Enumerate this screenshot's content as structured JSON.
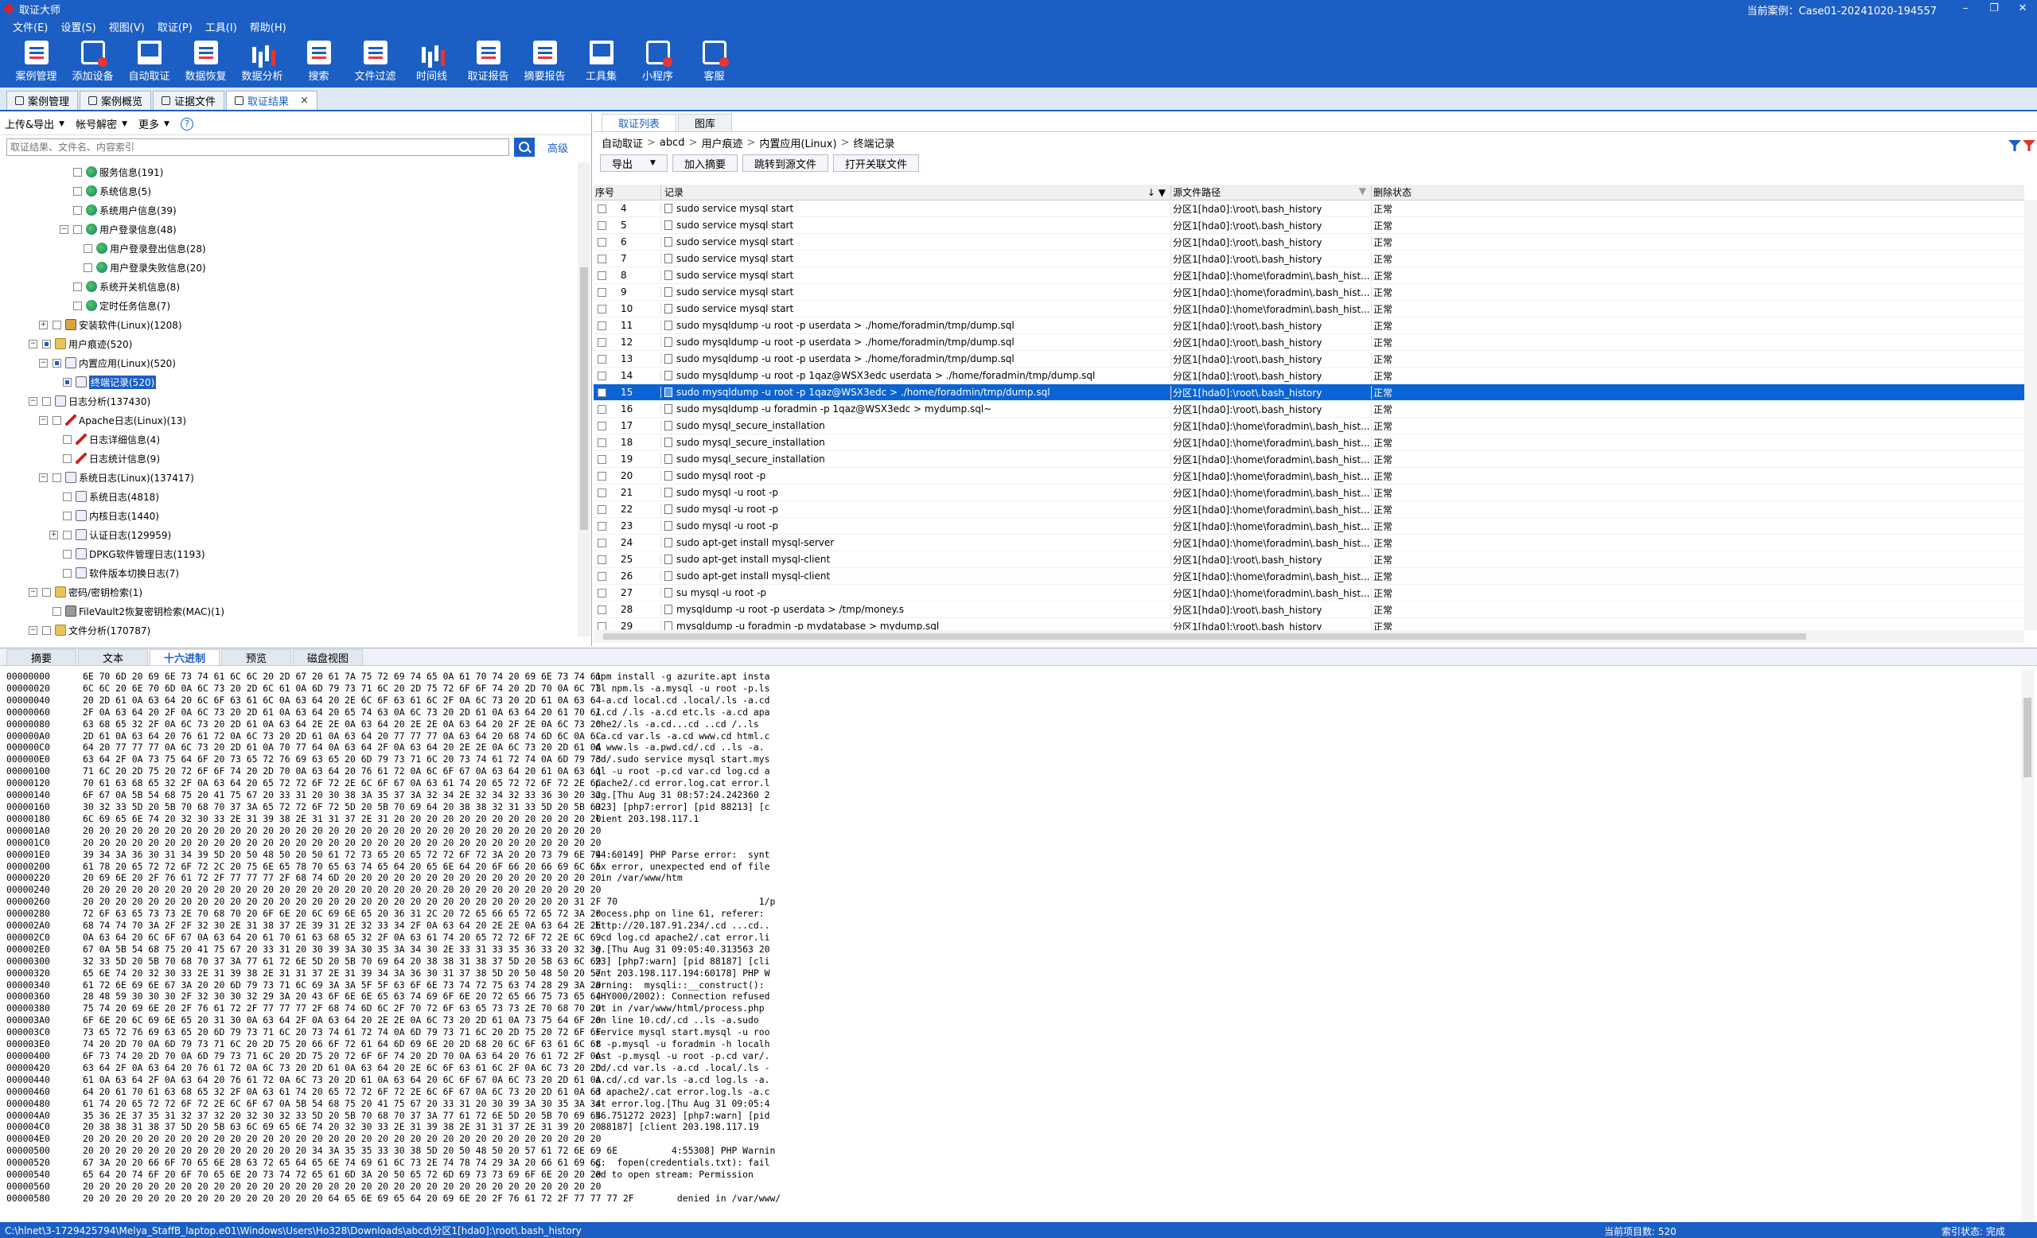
{
  "window": {
    "title": "取证大师",
    "current_case": "当前案例：Case01-20241020-194557",
    "min": "–",
    "max": "❐",
    "close": "✕"
  },
  "menu": [
    "文件(E)",
    "设置(S)",
    "视图(V)",
    "取证(P)",
    "工具(I)",
    "帮助(H)"
  ],
  "toolbar": [
    {
      "label": "案例管理",
      "icon": "case-manage-icon"
    },
    {
      "label": "添加设备",
      "icon": "add-device-icon"
    },
    {
      "label": "自动取证",
      "icon": "auto-forensics-icon"
    },
    {
      "label": "数据恢复",
      "icon": "data-recovery-icon"
    },
    {
      "label": "数据分析",
      "icon": "data-analysis-icon"
    },
    {
      "label": "搜索",
      "icon": "search-doc-icon"
    },
    {
      "label": "文件过滤",
      "icon": "file-filter-icon"
    },
    {
      "label": "时间线",
      "icon": "timeline-icon"
    },
    {
      "label": "取证报告",
      "icon": "report-icon"
    },
    {
      "label": "摘要报告",
      "icon": "summary-report-icon"
    },
    {
      "label": "工具集",
      "icon": "toolset-icon"
    },
    {
      "label": "小程序",
      "icon": "miniprogram-icon"
    },
    {
      "label": "客服",
      "icon": "support-icon"
    }
  ],
  "doc_tabs": [
    {
      "label": "案例管理",
      "active": false
    },
    {
      "label": "案例概览",
      "active": false
    },
    {
      "label": "证据文件",
      "active": false
    },
    {
      "label": "取证结果",
      "active": true,
      "close": "×"
    }
  ],
  "left": {
    "tools": {
      "upload_export": "上传&导出",
      "account_decrypt": "帐号解密",
      "more": "更多",
      "help": "?"
    },
    "search": {
      "placeholder": "取证结果、文件名、内容索引",
      "advanced": "高级"
    },
    "tree": [
      {
        "indent": 5,
        "exp": "",
        "label": "服务信息(191)",
        "icon": "green"
      },
      {
        "indent": 5,
        "exp": "",
        "label": "系统信息(5)",
        "icon": "green"
      },
      {
        "indent": 5,
        "exp": "",
        "label": "系统用户信息(39)",
        "icon": "green"
      },
      {
        "indent": 5,
        "exp": "−",
        "label": "用户登录信息(48)",
        "icon": "green"
      },
      {
        "indent": 6,
        "exp": "",
        "label": "用户登录登出信息(28)",
        "icon": "green"
      },
      {
        "indent": 6,
        "exp": "",
        "label": "用户登录失败信息(20)",
        "icon": "green"
      },
      {
        "indent": 5,
        "exp": "",
        "label": "系统开关机信息(8)",
        "icon": "green"
      },
      {
        "indent": 5,
        "exp": "",
        "label": "定时任务信息(7)",
        "icon": "green"
      },
      {
        "indent": 3,
        "exp": "+",
        "label": "安装软件(Linux)(1208)",
        "icon": "box"
      },
      {
        "indent": 2,
        "exp": "−",
        "label": "用户痕迹(520)",
        "icon": "folder",
        "partial": true
      },
      {
        "indent": 3,
        "exp": "−",
        "label": "内置应用(Linux)(520)",
        "icon": "doc",
        "partial": true
      },
      {
        "indent": 4,
        "exp": "",
        "label": "终端记录(520)",
        "icon": "doc",
        "partial": true,
        "selected": true
      },
      {
        "indent": 2,
        "exp": "−",
        "label": "日志分析(137430)",
        "icon": "doc"
      },
      {
        "indent": 3,
        "exp": "−",
        "label": "Apache日志(Linux)(13)",
        "icon": "red"
      },
      {
        "indent": 4,
        "exp": "",
        "label": "日志详细信息(4)",
        "icon": "red"
      },
      {
        "indent": 4,
        "exp": "",
        "label": "日志统计信息(9)",
        "icon": "red"
      },
      {
        "indent": 3,
        "exp": "−",
        "label": "系统日志(Linux)(137417)",
        "icon": "doc"
      },
      {
        "indent": 4,
        "exp": "",
        "label": "系统日志(4818)",
        "icon": "doc"
      },
      {
        "indent": 4,
        "exp": "",
        "label": "内核日志(1440)",
        "icon": "doc"
      },
      {
        "indent": 4,
        "exp": "+",
        "label": "认证日志(129959)",
        "icon": "doc"
      },
      {
        "indent": 4,
        "exp": "",
        "label": "DPKG软件管理日志(1193)",
        "icon": "doc"
      },
      {
        "indent": 4,
        "exp": "",
        "label": "软件版本切换日志(7)",
        "icon": "doc"
      },
      {
        "indent": 2,
        "exp": "−",
        "label": "密码/密钥检索(1)",
        "icon": "folder"
      },
      {
        "indent": 3,
        "exp": "",
        "label": "FileVault2恢复密钥检索(MAC)(1)",
        "icon": "lock"
      },
      {
        "indent": 2,
        "exp": "−",
        "label": "文件分析(170787)",
        "icon": "folder"
      }
    ]
  },
  "right": {
    "tabs": [
      {
        "label": "取证列表",
        "active": true
      },
      {
        "label": "图库",
        "active": false
      }
    ],
    "breadcrumb": [
      "自动取证",
      "abcd",
      "用户痕迹",
      "内置应用(Linux)",
      "终端记录"
    ],
    "breadcrumb_sep": ">",
    "actions": {
      "export": "导出",
      "add_summary": "加入摘要",
      "jump_source": "跳转到源文件",
      "open_related": "打开关联文件"
    },
    "columns": {
      "no": "序号",
      "record": "记录",
      "source": "源文件路径",
      "deleted": "删除状态"
    },
    "rows": [
      {
        "no": "4",
        "record": "sudo service mysql start",
        "source": "分区1[hda0]:\\root\\.bash_history",
        "deleted": "正常"
      },
      {
        "no": "5",
        "record": "sudo service mysql start",
        "source": "分区1[hda0]:\\root\\.bash_history",
        "deleted": "正常"
      },
      {
        "no": "6",
        "record": "sudo service mysql start",
        "source": "分区1[hda0]:\\root\\.bash_history",
        "deleted": "正常"
      },
      {
        "no": "7",
        "record": "sudo service mysql start",
        "source": "分区1[hda0]:\\root\\.bash_history",
        "deleted": "正常"
      },
      {
        "no": "8",
        "record": "sudo service mysql start",
        "source": "分区1[hda0]:\\home\\foradmin\\.bash_hist...",
        "deleted": "正常"
      },
      {
        "no": "9",
        "record": "sudo service mysql start",
        "source": "分区1[hda0]:\\home\\foradmin\\.bash_hist...",
        "deleted": "正常"
      },
      {
        "no": "10",
        "record": "sudo service mysql start",
        "source": "分区1[hda0]:\\home\\foradmin\\.bash_hist...",
        "deleted": "正常"
      },
      {
        "no": "11",
        "record": "sudo mysqldump -u root -p userdata > ./home/foradmin/tmp/dump.sql",
        "source": "分区1[hda0]:\\root\\.bash_history",
        "deleted": "正常"
      },
      {
        "no": "12",
        "record": "sudo mysqldump -u root -p userdata > ./home/foradmin/tmp/dump.sql",
        "source": "分区1[hda0]:\\root\\.bash_history",
        "deleted": "正常"
      },
      {
        "no": "13",
        "record": "sudo mysqldump -u root -p userdata > ./home/foradmin/tmp/dump.sql",
        "source": "分区1[hda0]:\\root\\.bash_history",
        "deleted": "正常"
      },
      {
        "no": "14",
        "record": "sudo mysqldump -u root -p 1qaz@WSX3edc userdata > ./home/foradmin/tmp/dump.sql",
        "source": "分区1[hda0]:\\root\\.bash_history",
        "deleted": "正常"
      },
      {
        "no": "15",
        "record": "sudo mysqldump -u root -p 1qaz@WSX3edc > ./home/foradmin/tmp/dump.sql",
        "source": "分区1[hda0]:\\root\\.bash_history",
        "deleted": "正常",
        "selected": true
      },
      {
        "no": "16",
        "record": "sudo mysqldump -u foradmin -p 1qaz@WSX3edc > mydump.sql~",
        "source": "分区1[hda0]:\\root\\.bash_history",
        "deleted": "正常"
      },
      {
        "no": "17",
        "record": "sudo mysql_secure_installation",
        "source": "分区1[hda0]:\\home\\foradmin\\.bash_hist...",
        "deleted": "正常"
      },
      {
        "no": "18",
        "record": "sudo mysql_secure_installation",
        "source": "分区1[hda0]:\\home\\foradmin\\.bash_hist...",
        "deleted": "正常"
      },
      {
        "no": "19",
        "record": "sudo mysql_secure_installation",
        "source": "分区1[hda0]:\\home\\foradmin\\.bash_hist...",
        "deleted": "正常"
      },
      {
        "no": "20",
        "record": "sudo mysql root -p",
        "source": "分区1[hda0]:\\home\\foradmin\\.bash_hist...",
        "deleted": "正常"
      },
      {
        "no": "21",
        "record": "sudo mysql -u root -p",
        "source": "分区1[hda0]:\\home\\foradmin\\.bash_hist...",
        "deleted": "正常"
      },
      {
        "no": "22",
        "record": "sudo mysql -u root -p",
        "source": "分区1[hda0]:\\home\\foradmin\\.bash_hist...",
        "deleted": "正常"
      },
      {
        "no": "23",
        "record": "sudo mysql -u root -p",
        "source": "分区1[hda0]:\\home\\foradmin\\.bash_hist...",
        "deleted": "正常"
      },
      {
        "no": "24",
        "record": "sudo apt-get install mysql-server",
        "source": "分区1[hda0]:\\home\\foradmin\\.bash_hist...",
        "deleted": "正常"
      },
      {
        "no": "25",
        "record": "sudo apt-get install mysql-client",
        "source": "分区1[hda0]:\\root\\.bash_history",
        "deleted": "正常"
      },
      {
        "no": "26",
        "record": "sudo apt-get install mysql-client",
        "source": "分区1[hda0]:\\home\\foradmin\\.bash_hist...",
        "deleted": "正常"
      },
      {
        "no": "27",
        "record": "su mysql -u root -p",
        "source": "分区1[hda0]:\\home\\foradmin\\.bash_hist...",
        "deleted": "正常"
      },
      {
        "no": "28",
        "record": "mysqldump -u root -p userdata > /tmp/money.s",
        "source": "分区1[hda0]:\\root\\.bash_history",
        "deleted": "正常"
      },
      {
        "no": "29",
        "record": "mysqldump -u foradmin -p mydatabase > mydump.sql",
        "source": "分区1[hda0]:\\root\\.bash_history",
        "deleted": "正常"
      }
    ]
  },
  "bottom": {
    "tabs": [
      {
        "label": "摘要",
        "active": false
      },
      {
        "label": "文本",
        "active": false
      },
      {
        "label": "十六进制",
        "active": true
      },
      {
        "label": "预览",
        "active": false
      },
      {
        "label": "磁盘视图",
        "active": false
      }
    ],
    "hex": [
      [
        "00000000",
        "6E 70 6D 20 69 6E 73 74 61 6C 6C 20 2D 67 20 61 7A 75 72 69 74 65 0A 61 70 74 20 69 6E 73 74 61",
        "npm install -g azurite.apt insta"
      ],
      [
        "00000020",
        "6C 6C 20 6E 70 6D 0A 6C 73 20 2D 6C 61 0A 6D 79 73 71 6C 20 2D 75 72 6F 6F 74 20 2D 70 0A 6C 73",
        "ll npm.ls -a.mysql -u root -p.ls"
      ],
      [
        "00000040",
        "20 2D 61 0A 63 64 20 6C 6F 63 61 6C 0A 63 64 20 2E 6C 6F 63 61 6C 2F 0A 6C 73 20 2D 61 0A 63 64",
        " -a.cd local.cd .local/.ls -a.cd"
      ],
      [
        "00000060",
        "2F 0A 63 64 20 2F 0A 6C 73 20 2D 61 0A 63 64 20 65 74 63 0A 6C 73 20 2D 61 0A 63 64 20 61 70 61",
        "/.cd /.ls -a.cd etc.ls -a.cd apa"
      ],
      [
        "00000080",
        "63 68 65 32 2F 0A 6C 73 20 2D 61 0A 63 64 2E 2E 0A 63 64 20 2E 2E 0A 63 64 20 2F 2E 0A 6C 73 20",
        "che2/.ls -a.cd...cd ..cd /..ls "
      ],
      [
        "000000A0",
        "2D 61 0A 63 64 20 76 61 72 0A 6C 73 20 2D 61 0A 63 64 20 77 77 77 0A 63 64 20 68 74 6D 6C 0A 6C",
        "-a.cd var.ls -a.cd www.cd html.c"
      ],
      [
        "000000C0",
        "64 20 77 77 77 0A 6C 73 20 2D 61 0A 70 77 64 0A 63 64 2F 0A 63 64 20 2E 2E 0A 6C 73 20 2D 61 0A",
        "d www.ls -a.pwd.cd/.cd ..ls -a."
      ],
      [
        "000000E0",
        "63 64 2F 0A 73 75 64 6F 20 73 65 72 76 69 63 65 20 6D 79 73 71 6C 20 73 74 61 72 74 0A 6D 79 73",
        "cd/.sudo service mysql start.mys"
      ],
      [
        "00000100",
        "71 6C 20 2D 75 20 72 6F 6F 74 20 2D 70 0A 63 64 20 76 61 72 0A 6C 6F 67 0A 63 64 20 61 0A 63 61",
        "ql -u root -p.cd var.cd log.cd a"
      ],
      [
        "00000120",
        "70 61 63 68 65 32 2F 0A 63 64 20 65 72 72 6F 72 2E 6C 6F 67 0A 63 61 74 20 65 72 72 6F 72 2E 6C",
        "pache2/.cd error.log.cat error.l"
      ],
      [
        "00000140",
        "6F 67 0A 5B 54 68 75 20 41 75 67 20 33 31 20 30 38 3A 35 37 3A 32 34 2E 32 34 32 33 36 30 20 32",
        "og.[Thu Aug 31 08:57:24.242360 2"
      ],
      [
        "00000160",
        "30 32 33 5D 20 5B 70 68 70 37 3A 65 72 72 6F 72 5D 20 5B 70 69 64 20 38 38 32 31 33 5D 20 5B 63",
        "023] [php7:error] [pid 88213] [c"
      ],
      [
        "00000180",
        "6C 69 65 6E 74 20 32 30 33 2E 31 39 38 2E 31 31 37 2E 31 20 20 20 20 20 20 20 20 20 20 20 20 20",
        "lient 203.198.117.1"
      ],
      [
        "000001A0",
        "20 20 20 20 20 20 20 20 20 20 20 20 20 20 20 20 20 20 20 20 20 20 20 20 20 20 20 20 20 20 20 20",
        ""
      ],
      [
        "000001C0",
        "20 20 20 20 20 20 20 20 20 20 20 20 20 20 20 20 20 20 20 20 20 20 20 20 20 20 20 20 20 20 20 20",
        ""
      ],
      [
        "000001E0",
        "39 34 3A 36 30 31 34 39 5D 20 50 48 50 20 50 61 72 73 65 20 65 72 72 6F 72 3A 20 20 73 79 6E 74",
        "94:60149] PHP Parse error:  synt"
      ],
      [
        "00000200",
        "61 78 20 65 72 72 6F 72 2C 20 75 6E 65 78 70 65 63 74 65 64 20 65 6E 64 20 6F 66 20 66 69 6C 65",
        "ax error, unexpected end of file"
      ],
      [
        "00000220",
        "20 69 6E 20 2F 76 61 72 2F 77 77 77 2F 68 74 6D 20 20 20 20 20 20 20 20 20 20 20 20 20 20 20 20",
        " in /var/www/htm"
      ],
      [
        "00000240",
        "20 20 20 20 20 20 20 20 20 20 20 20 20 20 20 20 20 20 20 20 20 20 20 20 20 20 20 20 20 20 20 20",
        ""
      ],
      [
        "00000260",
        "20 20 20 20 20 20 20 20 20 20 20 20 20 20 20 20 20 20 20 20 20 20 20 20 20 20 20 20 20 20 31 2F 70",
        "                              1/p"
      ],
      [
        "00000280",
        "72 6F 63 65 73 73 2E 70 68 70 20 6F 6E 20 6C 69 6E 65 20 36 31 2C 20 72 65 66 65 72 65 72 3A 20",
        "rocess.php on line 61, referer: "
      ],
      [
        "000002A0",
        "68 74 74 70 3A 2F 2F 32 30 2E 31 38 37 2E 39 31 2E 32 33 34 2F 0A 63 64 20 2E 2E 0A 63 64 2E 2E",
        "http://20.187.91.234/.cd ...cd.."
      ],
      [
        "000002C0",
        "0A 63 64 20 6C 6F 67 0A 63 64 20 61 70 61 63 68 65 32 2F 0A 63 61 74 20 65 72 72 6F 72 2E 6C 69",
        ".cd log.cd apache2/.cat error.li"
      ],
      [
        "000002E0",
        "67 0A 5B 54 68 75 20 41 75 67 20 33 31 20 30 39 3A 30 35 3A 34 30 2E 33 31 33 35 36 33 20 32 30",
        "g.[Thu Aug 31 09:05:40.313563 20"
      ],
      [
        "00000300",
        "32 33 5D 20 5B 70 68 70 37 3A 77 61 72 6E 5D 20 5B 70 69 64 20 38 38 31 38 37 5D 20 5B 63 6C 69",
        "23] [php7:warn] [pid 88187] [cli"
      ],
      [
        "00000320",
        "65 6E 74 20 32 30 33 2E 31 39 38 2E 31 31 37 2E 31 39 34 3A 36 30 31 37 38 5D 20 50 48 50 20 57",
        "ent 203.198.117.194:60178] PHP W"
      ],
      [
        "00000340",
        "61 72 6E 69 6E 67 3A 20 20 6D 79 73 71 6C 69 3A 3A 5F 5F 63 6F 6E 73 74 72 75 63 74 28 29 3A 20",
        "arning:  mysqli::__construct(): "
      ],
      [
        "00000360",
        "28 48 59 30 30 30 2F 32 30 30 32 29 3A 20 43 6F 6E 6E 65 63 74 69 6F 6E 20 72 65 66 75 73 65 64",
        "(HY000/2002): Connection refused"
      ],
      [
        "00000380",
        "75 74 20 69 6E 20 2F 76 61 72 2F 77 77 77 2F 68 74 6D 6C 2F 70 72 6F 63 65 73 73 2E 70 68 70 20",
        "ut in /var/www/html/process.php "
      ],
      [
        "000003A0",
        "6F 6E 20 6C 69 6E 65 20 31 30 0A 63 64 2F 0A 63 64 20 2E 2E 0A 6C 73 20 2D 61 0A 73 75 64 6F 20",
        "on line 10.cd/.cd ..ls -a.sudo "
      ],
      [
        "000003C0",
        "73 65 72 76 69 63 65 20 6D 79 73 71 6C 20 73 74 61 72 74 0A 6D 79 73 71 6C 20 2D 75 20 72 6F 6F",
        "service mysql start.mysql -u roo"
      ],
      [
        "000003E0",
        "74 20 2D 70 0A 6D 79 73 71 6C 20 2D 75 20 66 6F 72 61 64 6D 69 6E 20 2D 68 20 6C 6F 63 61 6C 68",
        "t -p.mysql -u foradmin -h localh"
      ],
      [
        "00000400",
        "6F 73 74 20 2D 70 0A 6D 79 73 71 6C 20 2D 75 20 72 6F 6F 74 20 2D 70 0A 63 64 20 76 61 72 2F 0A",
        "ost -p.mysql -u root -p.cd var/."
      ],
      [
        "00000420",
        "63 64 2F 0A 63 64 20 76 61 72 0A 6C 73 20 2D 61 0A 63 64 20 2E 6C 6F 63 61 6C 2F 0A 6C 73 20 2D",
        "cd/.cd var.ls -a.cd .local/.ls -"
      ],
      [
        "00000440",
        "61 0A 63 64 2F 0A 63 64 20 76 61 72 0A 6C 73 20 2D 61 0A 63 64 20 6C 6F 67 0A 6C 73 20 2D 61 0A",
        "a.cd/.cd var.ls -a.cd log.ls -a."
      ],
      [
        "00000460",
        "64 20 61 70 61 63 68 65 32 2F 0A 63 61 74 20 65 72 72 6F 72 2E 6C 6F 67 0A 6C 73 20 2D 61 0A 63",
        "d apache2/.cat error.log.ls -a.c"
      ],
      [
        "00000480",
        "61 74 20 65 72 72 6F 72 2E 6C 6F 67 0A 5B 54 68 75 20 41 75 67 20 33 31 20 30 39 3A 30 35 3A 34",
        "at error.log.[Thu Aug 31 09:05:4"
      ],
      [
        "000004A0",
        "35 36 2E 37 35 31 32 37 32 20 32 30 32 33 5D 20 5B 70 68 70 37 3A 77 61 72 6E 5D 20 5B 70 69 64",
        "56.751272 2023] [php7:warn] [pid"
      ],
      [
        "000004C0",
        "20 38 38 31 38 37 5D 20 5B 63 6C 69 65 6E 74 20 32 30 33 2E 31 39 38 2E 31 31 37 2E 31 39 20 20",
        " 88187] [client 203.198.117.19"
      ],
      [
        "000004E0",
        "20 20 20 20 20 20 20 20 20 20 20 20 20 20 20 20 20 20 20 20 20 20 20 20 20 20 20 20 20 20 20 20",
        ""
      ],
      [
        "00000500",
        "20 20 20 20 20 20 20 20 20 20 20 20 20 20 34 3A 35 35 33 30 38 5D 20 50 48 50 20 57 61 72 6E 69 6E",
        "              4:55308] PHP Warnin"
      ],
      [
        "00000520",
        "67 3A 20 20 66 6F 70 65 6E 28 63 72 65 64 65 6E 74 69 61 6C 73 2E 74 78 74 29 3A 20 66 61 69 6C",
        "g:  fopen(credentials.txt): fail"
      ],
      [
        "00000540",
        "65 64 20 74 6F 20 6F 70 65 6E 20 73 74 72 65 61 6D 3A 20 50 65 72 6D 69 73 73 69 6F 6E 20 20 20",
        "ed to open stream: Permission"
      ],
      [
        "00000560",
        "20 20 20 20 20 20 20 20 20 20 20 20 20 20 20 20 20 20 20 20 20 20 20 20 20 20 20 20 20 20 20 20",
        ""
      ],
      [
        "00000580",
        "20 20 20 20 20 20 20 20 20 20 20 20 20 20 20 64 65 6E 69 65 64 20 69 6E 20 2F 76 61 72 2F 77 77 77 2F",
        "               denied in /var/www/"
      ]
    ]
  },
  "status": {
    "path": "C:\\hlnet\\3-1729425794\\Melya_StaffB_laptop.e01\\Windows\\Users\\Ho328\\Downloads\\abcd\\分区1[hda0]:\\root\\.bash_history",
    "count": "当前项目数: 520",
    "index": "索引状态: 完成"
  }
}
